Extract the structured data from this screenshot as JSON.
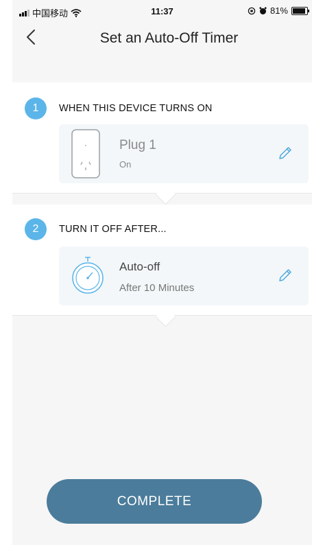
{
  "status_bar": {
    "carrier": "中国移动",
    "time": "11:37",
    "battery": "81%"
  },
  "header": {
    "title": "Set an Auto-Off Timer"
  },
  "steps": [
    {
      "number": "1",
      "label": "WHEN THIS DEVICE TURNS ON",
      "card": {
        "title": "Plug 1",
        "subtitle": "On",
        "icon": "plug-icon"
      }
    },
    {
      "number": "2",
      "label": "TURN IT OFF AFTER...",
      "card": {
        "title": "Auto-off",
        "subtitle": "After 10 Minutes",
        "icon": "stopwatch-icon"
      }
    }
  ],
  "footer": {
    "button_label": "COMPLETE"
  },
  "colors": {
    "accent": "#5bb5e8",
    "button": "#4b7c9b",
    "card_bg": "#f3f7f9"
  }
}
